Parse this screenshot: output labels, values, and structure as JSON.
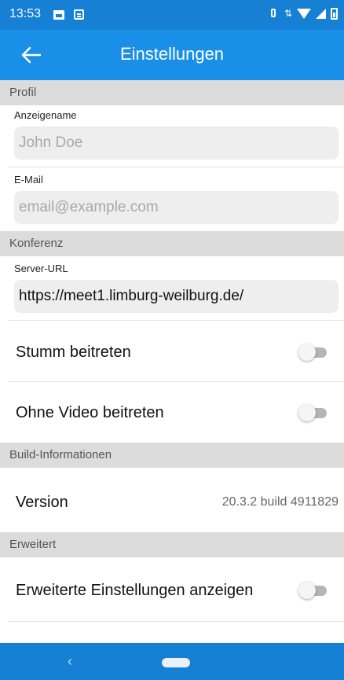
{
  "status_bar": {
    "time": "13:53",
    "icons": [
      "image-icon",
      "message-icon",
      "vibrate-icon",
      "data-arrows-icon",
      "wifi-icon",
      "signal-icon",
      "battery-icon"
    ]
  },
  "app_bar": {
    "title": "Einstellungen",
    "back_icon": "arrow-left-icon"
  },
  "sections": {
    "profile": {
      "header": "Profil",
      "display_name": {
        "label": "Anzeigename",
        "placeholder": "John Doe",
        "value": ""
      },
      "email": {
        "label": "E-Mail",
        "placeholder": "email@example.com",
        "value": ""
      }
    },
    "conference": {
      "header": "Konferenz",
      "server_url": {
        "label": "Server-URL",
        "value": "https://meet1.limburg-weilburg.de/"
      },
      "mute_join": {
        "label": "Stumm beitreten",
        "enabled": false
      },
      "video_off_join": {
        "label": "Ohne Video beitreten",
        "enabled": false
      }
    },
    "build": {
      "header": "Build-Informationen",
      "version_label": "Version",
      "version_value": "20.3.2 build 4911829"
    },
    "advanced": {
      "header": "Erweitert",
      "show_advanced": {
        "label": "Erweiterte Einstellungen anzeigen",
        "enabled": false
      }
    }
  },
  "nav_bar": {
    "back_glyph": "‹",
    "icons": [
      "back-icon",
      "home-pill-icon"
    ]
  },
  "colors": {
    "status_bar": "#1580d4",
    "app_bar": "#1a8fe8",
    "section_header_bg": "#dcdcdc",
    "input_bg": "#eeeeee",
    "toggle_off": "#b5b5b5"
  }
}
